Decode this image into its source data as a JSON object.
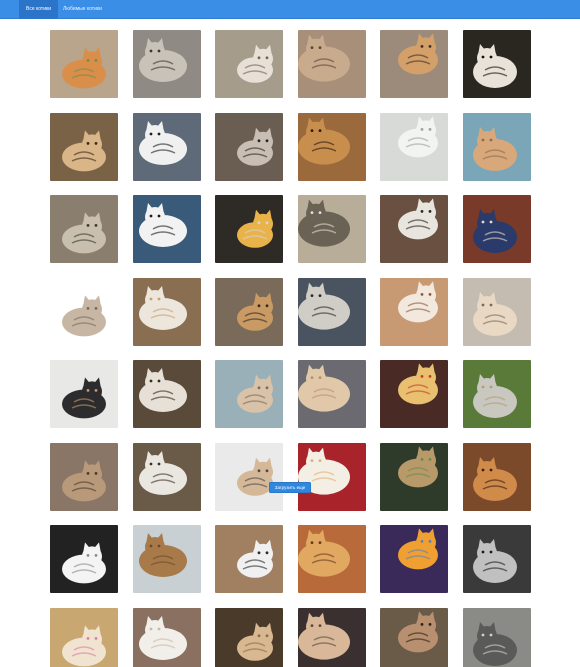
{
  "navbar": {
    "tabs": [
      {
        "label": "Все котики",
        "active": true
      },
      {
        "label": "Любимые котики",
        "active": false
      }
    ],
    "accent_color": "#3a8ee6"
  },
  "gallery": {
    "tile_kind": "cat-photo",
    "rows": 8,
    "columns": 6,
    "tiles": [
      {
        "bg": "#b8a58c",
        "accent": "#d98f4a",
        "mark": "#6b8f4e"
      },
      {
        "bg": "#8f8a84",
        "accent": "#c9c2b8",
        "mark": "#3b3732"
      },
      {
        "bg": "#a59c8c",
        "accent": "#e6e0d6",
        "mark": "#6e6458"
      },
      {
        "bg": "#a88f7a",
        "accent": "#c8aa8c",
        "mark": "#5a463a"
      },
      {
        "bg": "#9c8b7a",
        "accent": "#d4a06a",
        "mark": "#3b2f2a"
      },
      {
        "bg": "#2a2620",
        "accent": "#e9e2d8",
        "mark": "#111111"
      },
      {
        "bg": "#7a6246",
        "accent": "#d9b587",
        "mark": "#3a2a1c"
      },
      {
        "bg": "#5e6a78",
        "accent": "#f0f0f0",
        "mark": "#1e1e22"
      },
      {
        "bg": "#6a5d52",
        "accent": "#c9beb4",
        "mark": "#2a2420"
      },
      {
        "bg": "#9a6a3c",
        "accent": "#c88e4e",
        "mark": "#2b1c10"
      },
      {
        "bg": "#d8dad8",
        "accent": "#f3f3f1",
        "mark": "#9aa4a0"
      },
      {
        "bg": "#7aa6b8",
        "accent": "#d9a87a",
        "mark": "#8c6a4a"
      },
      {
        "bg": "#8a7f6e",
        "accent": "#c9bfae",
        "mark": "#3e3830"
      },
      {
        "bg": "#3a5a7a",
        "accent": "#f2f2f2",
        "mark": "#1c1c1c"
      },
      {
        "bg": "#2e2a26",
        "accent": "#e9b34a",
        "mark": "#d8d4cf"
      },
      {
        "bg": "#b8ad98",
        "accent": "#6a6254",
        "mark": "#e4dccc"
      },
      {
        "bg": "#6a5040",
        "accent": "#e8e4de",
        "mark": "#2c2420"
      },
      {
        "bg": "#7a3a2a",
        "accent": "#2a3a6a",
        "mark": "#e6dcc8"
      },
      {
        "bg": "#ffffff",
        "accent": "#c7b6a4",
        "mark": "#7a6a5a"
      },
      {
        "bg": "#8a6e52",
        "accent": "#ece6dc",
        "mark": "#c8a070"
      },
      {
        "bg": "#7a6a5a",
        "accent": "#c99a64",
        "mark": "#2e2a26"
      },
      {
        "bg": "#4a5460",
        "accent": "#d0ccc6",
        "mark": "#2a2a2c"
      },
      {
        "bg": "#c89a74",
        "accent": "#f2e8de",
        "mark": "#8c5a3a"
      },
      {
        "bg": "#c4bcb0",
        "accent": "#e8d8c4",
        "mark": "#7a6a58"
      },
      {
        "bg": "#e8e8e6",
        "accent": "#2c2c2e",
        "mark": "#c49a6a"
      },
      {
        "bg": "#5a4a3a",
        "accent": "#e6e0d6",
        "mark": "#3a2a1a"
      },
      {
        "bg": "#9ab0b8",
        "accent": "#d8c2a8",
        "mark": "#7a6a5a"
      },
      {
        "bg": "#6a6a70",
        "accent": "#e0c8a8",
        "mark": "#b89070"
      },
      {
        "bg": "#4a2a24",
        "accent": "#e8c070",
        "mark": "#c83a2a"
      },
      {
        "bg": "#5a7a3a",
        "accent": "#c8c8c0",
        "mark": "#b89a70"
      },
      {
        "bg": "#8a7666",
        "accent": "#b89a7a",
        "mark": "#4a3a2e"
      },
      {
        "bg": "#6a5a48",
        "accent": "#eae6e0",
        "mark": "#3a322a"
      },
      {
        "bg": "#eaeaea",
        "accent": "#d4b898",
        "mark": "#4a4a4a"
      },
      {
        "bg": "#a8242a",
        "accent": "#f4efe4",
        "mark": "#e0b070"
      },
      {
        "bg": "#2e3a2a",
        "accent": "#b89a6a",
        "mark": "#6a8a4a"
      },
      {
        "bg": "#7a4a2a",
        "accent": "#d08a4a",
        "mark": "#3a2014"
      },
      {
        "bg": "#222222",
        "accent": "#f4f4f4",
        "mark": "#8a8a8a"
      },
      {
        "bg": "#c8d0d4",
        "accent": "#a87a4a",
        "mark": "#6a4a2a"
      },
      {
        "bg": "#a08060",
        "accent": "#f0f0f0",
        "mark": "#2a2a2a"
      },
      {
        "bg": "#b86a3a",
        "accent": "#e0a860",
        "mark": "#6a3a20"
      },
      {
        "bg": "#3a2a5a",
        "accent": "#f0a030",
        "mark": "#5a80c0"
      },
      {
        "bg": "#3a3a3a",
        "accent": "#c0c0c0",
        "mark": "#1a1a1a"
      },
      {
        "bg": "#c8a870",
        "accent": "#f0e4d0",
        "mark": "#e07aa8"
      },
      {
        "bg": "#8a7060",
        "accent": "#f2efea",
        "mark": "#c8b8a8"
      },
      {
        "bg": "#4a3a2a",
        "accent": "#d8b890",
        "mark": "#8a6a4a"
      },
      {
        "bg": "#3a3030",
        "accent": "#d8b898",
        "mark": "#5a4a40"
      },
      {
        "bg": "#6a5a48",
        "accent": "#b89070",
        "mark": "#2a2018"
      },
      {
        "bg": "#8a8a86",
        "accent": "#5a5a58",
        "mark": "#d0d0cc"
      }
    ]
  },
  "load_more": {
    "label": "Загрузить еще"
  }
}
